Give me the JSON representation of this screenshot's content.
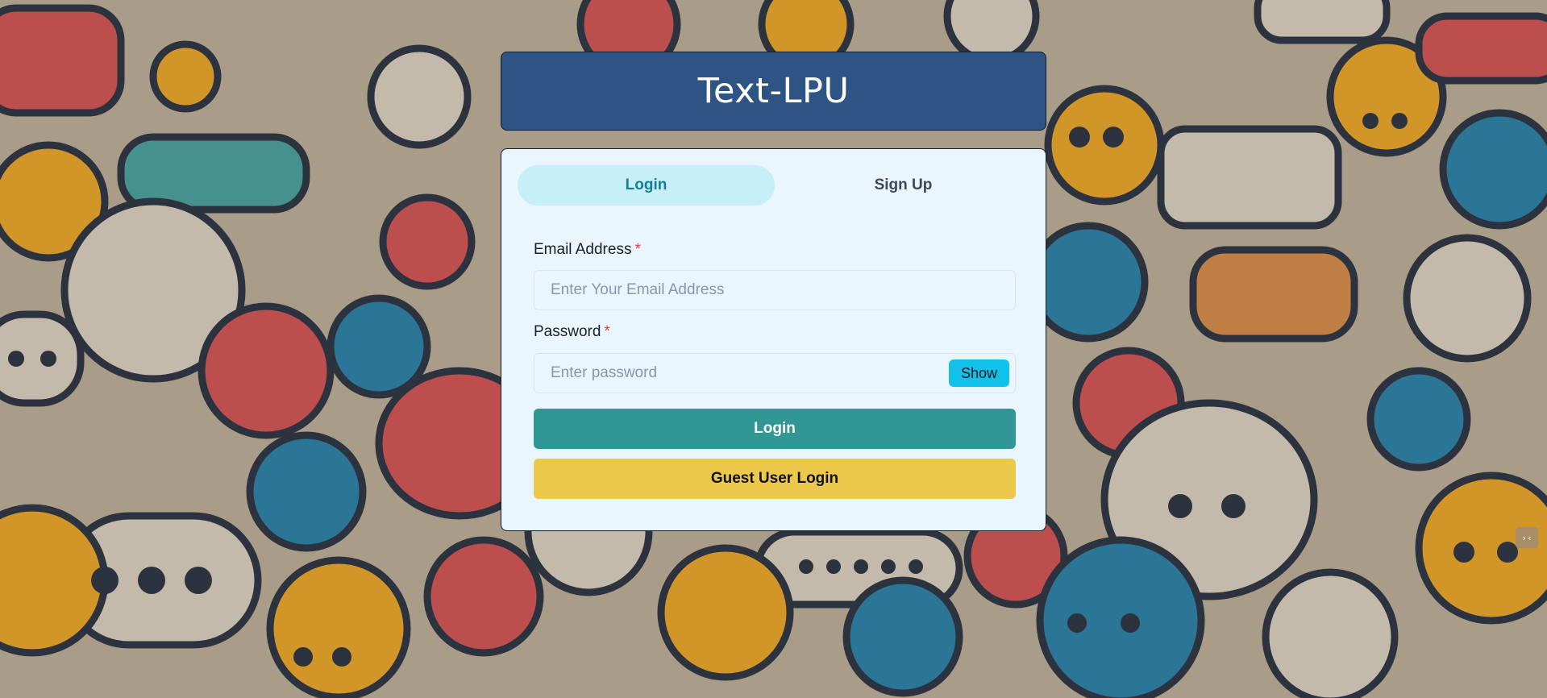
{
  "app": {
    "title": "Text-LPU"
  },
  "tabs": [
    {
      "label": "Login",
      "active": true
    },
    {
      "label": "Sign Up",
      "active": false
    }
  ],
  "login_form": {
    "email": {
      "label": "Email Address",
      "required_mark": "*",
      "placeholder": "Enter Your Email Address",
      "value": ""
    },
    "password": {
      "label": "Password",
      "required_mark": "*",
      "placeholder": "Enter password",
      "value": "",
      "toggle_label": "Show"
    },
    "submit_label": "Login",
    "guest_label": "Guest User Login"
  },
  "overlay_icon": {
    "name": "extension-icon",
    "glyph": "›‹"
  },
  "colors": {
    "header_bg": "#2e5485",
    "card_bg": "#eaf6fd",
    "active_tab_bg": "#c6eff7",
    "active_tab_text": "#127e97",
    "required": "#e53e3e",
    "show_button": "#12c1e9",
    "login_button": "#319795",
    "guest_button": "#ecc94b"
  },
  "background": {
    "description_icon": "chat-bubbles-pattern"
  }
}
